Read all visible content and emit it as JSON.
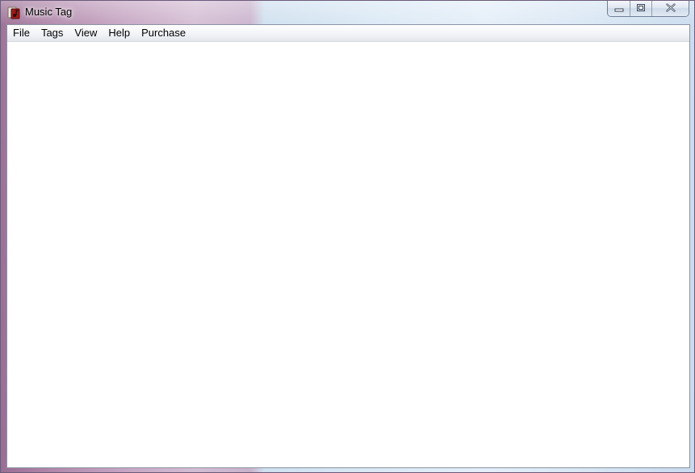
{
  "window": {
    "title": "Music Tag"
  },
  "menubar": {
    "items": [
      "File",
      "Tags",
      "View",
      "Help",
      "Purchase"
    ]
  },
  "icons": {
    "app": "music-tag-app-icon",
    "minimize": "minimize-icon",
    "maximize": "maximize-icon",
    "close": "close-icon"
  },
  "colors": {
    "client_background": "#ffffff",
    "menubar_background": "#f2f4f7"
  }
}
